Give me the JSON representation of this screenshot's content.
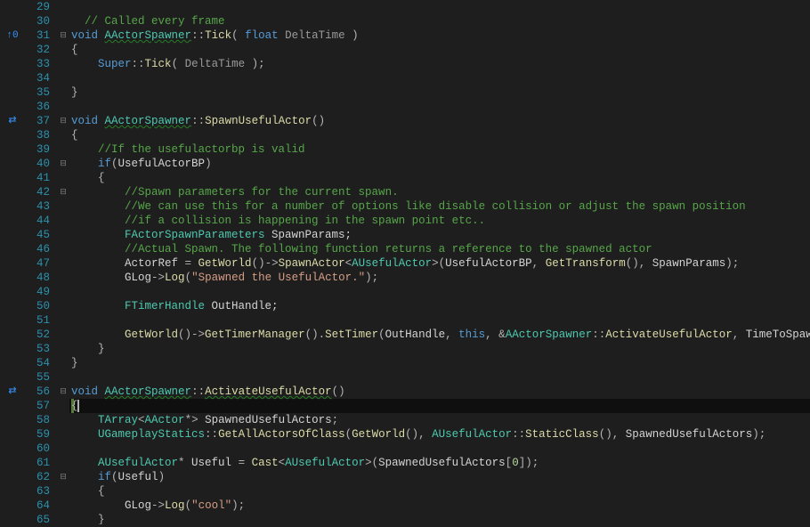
{
  "lines": [
    {
      "num": "29",
      "gutter": "",
      "fold": "",
      "frags": []
    },
    {
      "num": "30",
      "gutter": "",
      "fold": "",
      "frags": [
        {
          "t": "  ",
          "c": ""
        },
        {
          "t": "// Called every frame",
          "c": "comment"
        }
      ]
    },
    {
      "num": "31",
      "gutter": "↑0",
      "fold": "⊟",
      "frags": [
        {
          "t": "void",
          "c": "kw"
        },
        {
          "t": " ",
          "c": ""
        },
        {
          "t": "AActorSpawner",
          "c": "type wavy"
        },
        {
          "t": "::",
          "c": "punct"
        },
        {
          "t": "Tick",
          "c": "fn"
        },
        {
          "t": "( ",
          "c": "punct"
        },
        {
          "t": "float",
          "c": "kw"
        },
        {
          "t": " ",
          "c": ""
        },
        {
          "t": "DeltaTime",
          "c": "param"
        },
        {
          "t": " )",
          "c": "punct"
        }
      ]
    },
    {
      "num": "32",
      "gutter": "",
      "fold": "",
      "frags": [
        {
          "t": "{",
          "c": "punct"
        }
      ]
    },
    {
      "num": "33",
      "gutter": "",
      "fold": "",
      "frags": [
        {
          "t": "    ",
          "c": ""
        },
        {
          "t": "Super",
          "c": "kw"
        },
        {
          "t": "::",
          "c": "punct"
        },
        {
          "t": "Tick",
          "c": "fn"
        },
        {
          "t": "( ",
          "c": "punct"
        },
        {
          "t": "DeltaTime",
          "c": "param"
        },
        {
          "t": " );",
          "c": "punct"
        }
      ]
    },
    {
      "num": "34",
      "gutter": "",
      "fold": "",
      "frags": []
    },
    {
      "num": "35",
      "gutter": "",
      "fold": "",
      "frags": [
        {
          "t": "}",
          "c": "punct"
        }
      ]
    },
    {
      "num": "36",
      "gutter": "",
      "fold": "",
      "frags": []
    },
    {
      "num": "37",
      "gutter": "⇄",
      "fold": "⊟",
      "frags": [
        {
          "t": "void",
          "c": "kw"
        },
        {
          "t": " ",
          "c": ""
        },
        {
          "t": "AActorSpawner",
          "c": "type wavy"
        },
        {
          "t": "::",
          "c": "punct"
        },
        {
          "t": "SpawnUsefulActor",
          "c": "fn"
        },
        {
          "t": "()",
          "c": "punct"
        }
      ]
    },
    {
      "num": "38",
      "gutter": "",
      "fold": "",
      "frags": [
        {
          "t": "{",
          "c": "punct"
        }
      ]
    },
    {
      "num": "39",
      "gutter": "",
      "fold": "",
      "frags": [
        {
          "t": "    ",
          "c": ""
        },
        {
          "t": "//If the usefulactorbp is valid",
          "c": "comment"
        }
      ]
    },
    {
      "num": "40",
      "gutter": "",
      "fold": "⊟",
      "frags": [
        {
          "t": "    ",
          "c": ""
        },
        {
          "t": "if",
          "c": "kw"
        },
        {
          "t": "(",
          "c": "punct"
        },
        {
          "t": "UsefulActorBP",
          "c": "var"
        },
        {
          "t": ")",
          "c": "punct"
        }
      ]
    },
    {
      "num": "41",
      "gutter": "",
      "fold": "",
      "frags": [
        {
          "t": "    {",
          "c": "punct"
        }
      ]
    },
    {
      "num": "42",
      "gutter": "",
      "fold": "⊟",
      "frags": [
        {
          "t": "        ",
          "c": ""
        },
        {
          "t": "//Spawn parameters for the current spawn.",
          "c": "comment"
        }
      ]
    },
    {
      "num": "43",
      "gutter": "",
      "fold": "",
      "frags": [
        {
          "t": "        ",
          "c": ""
        },
        {
          "t": "//We can use this for a number of options like disable collision or adjust the spawn position",
          "c": "comment"
        }
      ]
    },
    {
      "num": "44",
      "gutter": "",
      "fold": "",
      "frags": [
        {
          "t": "        ",
          "c": ""
        },
        {
          "t": "//if a collision is happening in the spawn point etc..",
          "c": "comment"
        }
      ]
    },
    {
      "num": "45",
      "gutter": "",
      "fold": "",
      "frags": [
        {
          "t": "        ",
          "c": ""
        },
        {
          "t": "FActorSpawnParameters",
          "c": "type"
        },
        {
          "t": " SpawnParams;",
          "c": "var"
        }
      ]
    },
    {
      "num": "46",
      "gutter": "",
      "fold": "",
      "frags": [
        {
          "t": "        ",
          "c": ""
        },
        {
          "t": "//Actual Spawn. The following function returns a reference to the spawned actor",
          "c": "comment"
        }
      ]
    },
    {
      "num": "47",
      "gutter": "",
      "fold": "",
      "frags": [
        {
          "t": "        ",
          "c": ""
        },
        {
          "t": "ActorRef",
          "c": "var"
        },
        {
          "t": " = ",
          "c": "op"
        },
        {
          "t": "GetWorld",
          "c": "fn"
        },
        {
          "t": "()->",
          "c": "punct"
        },
        {
          "t": "SpawnActor",
          "c": "fn"
        },
        {
          "t": "<",
          "c": "punct"
        },
        {
          "t": "AUsefulActor",
          "c": "type"
        },
        {
          "t": ">(",
          "c": "punct"
        },
        {
          "t": "UsefulActorBP",
          "c": "var"
        },
        {
          "t": ", ",
          "c": "punct"
        },
        {
          "t": "GetTransform",
          "c": "fn"
        },
        {
          "t": "(), ",
          "c": "punct"
        },
        {
          "t": "SpawnParams",
          "c": "var"
        },
        {
          "t": ");",
          "c": "punct"
        }
      ]
    },
    {
      "num": "48",
      "gutter": "",
      "fold": "",
      "frags": [
        {
          "t": "        ",
          "c": ""
        },
        {
          "t": "GLog",
          "c": "var"
        },
        {
          "t": "->",
          "c": "punct"
        },
        {
          "t": "Log",
          "c": "fn"
        },
        {
          "t": "(",
          "c": "punct"
        },
        {
          "t": "\"Spawned the UsefulActor.\"",
          "c": "str"
        },
        {
          "t": ");",
          "c": "punct"
        }
      ]
    },
    {
      "num": "49",
      "gutter": "",
      "fold": "",
      "frags": []
    },
    {
      "num": "50",
      "gutter": "",
      "fold": "",
      "frags": [
        {
          "t": "        ",
          "c": ""
        },
        {
          "t": "FTimerHandle",
          "c": "type"
        },
        {
          "t": " OutHandle;",
          "c": "var"
        }
      ]
    },
    {
      "num": "51",
      "gutter": "",
      "fold": "",
      "frags": []
    },
    {
      "num": "52",
      "gutter": "",
      "fold": "",
      "frags": [
        {
          "t": "        ",
          "c": ""
        },
        {
          "t": "GetWorld",
          "c": "fn"
        },
        {
          "t": "()->",
          "c": "punct"
        },
        {
          "t": "GetTimerManager",
          "c": "fn"
        },
        {
          "t": "().",
          "c": "punct"
        },
        {
          "t": "SetTimer",
          "c": "fn"
        },
        {
          "t": "(",
          "c": "punct"
        },
        {
          "t": "OutHandle",
          "c": "var"
        },
        {
          "t": ", ",
          "c": "punct"
        },
        {
          "t": "this",
          "c": "kw"
        },
        {
          "t": ", &",
          "c": "punct"
        },
        {
          "t": "AActorSpawner",
          "c": "type"
        },
        {
          "t": "::",
          "c": "punct"
        },
        {
          "t": "ActivateUsefulActor",
          "c": "fn"
        },
        {
          "t": ", ",
          "c": "punct"
        },
        {
          "t": "TimeToSpawn",
          "c": "var"
        },
        {
          "t": ");",
          "c": "punct"
        }
      ]
    },
    {
      "num": "53",
      "gutter": "",
      "fold": "",
      "frags": [
        {
          "t": "    }",
          "c": "punct"
        }
      ]
    },
    {
      "num": "54",
      "gutter": "",
      "fold": "",
      "frags": [
        {
          "t": "}",
          "c": "punct"
        }
      ]
    },
    {
      "num": "55",
      "gutter": "",
      "fold": "",
      "frags": []
    },
    {
      "num": "56",
      "gutter": "⇄",
      "fold": "⊟",
      "frags": [
        {
          "t": "void",
          "c": "kw"
        },
        {
          "t": " ",
          "c": ""
        },
        {
          "t": "AActorSpawner",
          "c": "type wavy"
        },
        {
          "t": "::",
          "c": "punct"
        },
        {
          "t": "ActivateUsefulActor",
          "c": "fn wavy"
        },
        {
          "t": "()",
          "c": "punct"
        }
      ]
    },
    {
      "num": "57",
      "gutter": "",
      "fold": "",
      "current": true,
      "changebar": true,
      "frags": [
        {
          "t": "{",
          "c": "punct"
        },
        {
          "caret": true
        }
      ]
    },
    {
      "num": "58",
      "gutter": "",
      "fold": "",
      "frags": [
        {
          "t": "    ",
          "c": ""
        },
        {
          "t": "TArray",
          "c": "type"
        },
        {
          "t": "<",
          "c": "punct"
        },
        {
          "t": "AActor",
          "c": "type"
        },
        {
          "t": "*> ",
          "c": "punct"
        },
        {
          "t": "SpawnedUsefulActors",
          "c": "var"
        },
        {
          "t": ";",
          "c": "punct"
        }
      ]
    },
    {
      "num": "59",
      "gutter": "",
      "fold": "",
      "frags": [
        {
          "t": "    ",
          "c": ""
        },
        {
          "t": "UGameplayStatics",
          "c": "type"
        },
        {
          "t": "::",
          "c": "punct"
        },
        {
          "t": "GetAllActorsOfClass",
          "c": "fn"
        },
        {
          "t": "(",
          "c": "punct"
        },
        {
          "t": "GetWorld",
          "c": "fn"
        },
        {
          "t": "(), ",
          "c": "punct"
        },
        {
          "t": "AUsefulActor",
          "c": "type"
        },
        {
          "t": "::",
          "c": "punct"
        },
        {
          "t": "StaticClass",
          "c": "fn"
        },
        {
          "t": "(), ",
          "c": "punct"
        },
        {
          "t": "SpawnedUsefulActors",
          "c": "var"
        },
        {
          "t": ");",
          "c": "punct"
        }
      ]
    },
    {
      "num": "60",
      "gutter": "",
      "fold": "",
      "frags": []
    },
    {
      "num": "61",
      "gutter": "",
      "fold": "",
      "frags": [
        {
          "t": "    ",
          "c": ""
        },
        {
          "t": "AUsefulActor",
          "c": "type"
        },
        {
          "t": "* ",
          "c": "punct"
        },
        {
          "t": "Useful",
          "c": "var"
        },
        {
          "t": " = ",
          "c": "op"
        },
        {
          "t": "Cast",
          "c": "fn"
        },
        {
          "t": "<",
          "c": "punct"
        },
        {
          "t": "AUsefulActor",
          "c": "type"
        },
        {
          "t": ">(",
          "c": "punct"
        },
        {
          "t": "SpawnedUsefulActors",
          "c": "var"
        },
        {
          "t": "[",
          "c": "punct"
        },
        {
          "t": "0",
          "c": "num"
        },
        {
          "t": "]);",
          "c": "punct"
        }
      ]
    },
    {
      "num": "62",
      "gutter": "",
      "fold": "⊟",
      "frags": [
        {
          "t": "    ",
          "c": ""
        },
        {
          "t": "if",
          "c": "kw"
        },
        {
          "t": "(",
          "c": "punct"
        },
        {
          "t": "Useful",
          "c": "var"
        },
        {
          "t": ")",
          "c": "punct"
        }
      ]
    },
    {
      "num": "63",
      "gutter": "",
      "fold": "",
      "frags": [
        {
          "t": "    {",
          "c": "punct"
        }
      ]
    },
    {
      "num": "64",
      "gutter": "",
      "fold": "",
      "frags": [
        {
          "t": "        ",
          "c": ""
        },
        {
          "t": "GLog",
          "c": "var"
        },
        {
          "t": "->",
          "c": "punct"
        },
        {
          "t": "Log",
          "c": "fn"
        },
        {
          "t": "(",
          "c": "punct"
        },
        {
          "t": "\"cool\"",
          "c": "str"
        },
        {
          "t": ");",
          "c": "punct"
        }
      ]
    },
    {
      "num": "65",
      "gutter": "",
      "fold": "",
      "frags": [
        {
          "t": "    }",
          "c": "punct"
        }
      ]
    }
  ]
}
